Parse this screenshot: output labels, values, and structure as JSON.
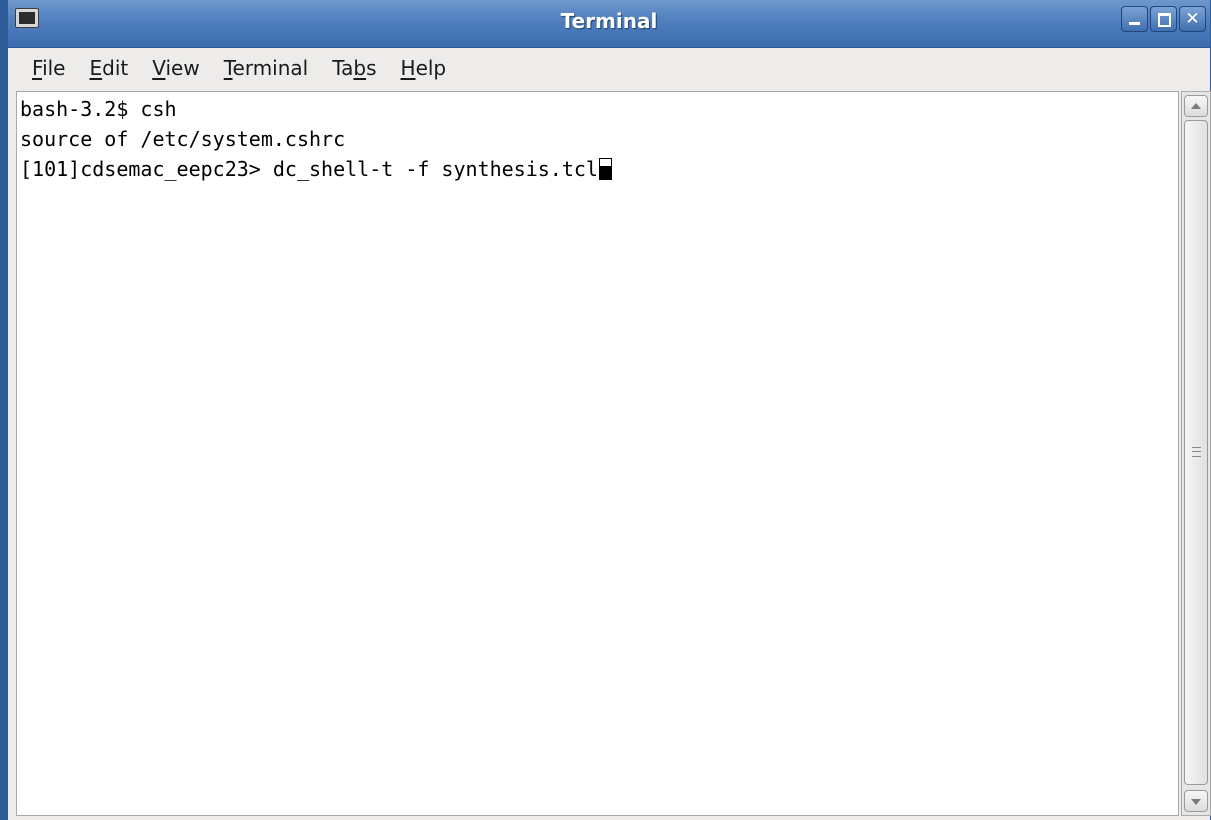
{
  "window": {
    "title": "Terminal"
  },
  "menubar": {
    "items": [
      {
        "mnemonic": "F",
        "rest": "ile"
      },
      {
        "mnemonic": "E",
        "rest": "dit"
      },
      {
        "mnemonic": "V",
        "rest": "iew"
      },
      {
        "mnemonic": "T",
        "rest": "erminal"
      },
      {
        "before": "Ta",
        "mnemonic": "b",
        "rest": "s"
      },
      {
        "mnemonic": "H",
        "rest": "elp"
      }
    ]
  },
  "terminal": {
    "lines": [
      "bash-3.2$ csh",
      "source of /etc/system.cshrc",
      "[101]cdsemac_eepc23> dc_shell-t -f synthesis.tcl"
    ]
  },
  "icons": {
    "app": "terminal-icon",
    "minimize": "minimize-icon",
    "maximize": "maximize-icon",
    "close": "close-icon"
  },
  "colors": {
    "titlebar": "#4f7fbe",
    "terminal_bg": "#ffffff",
    "terminal_fg": "#000000"
  }
}
